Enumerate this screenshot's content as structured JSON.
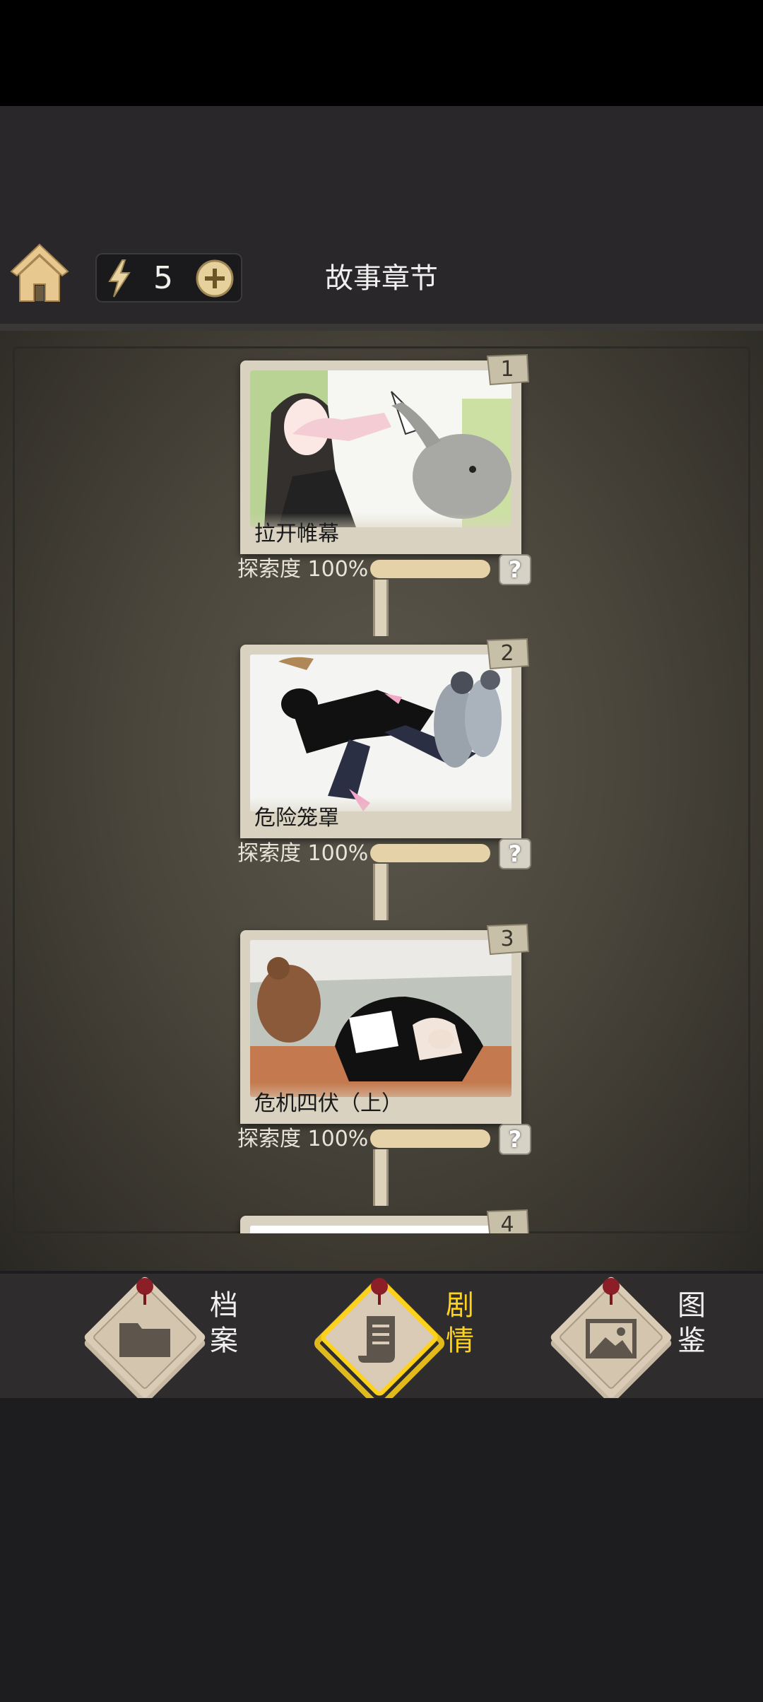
{
  "header": {
    "title": "故事章节",
    "energy": "5"
  },
  "chapters": [
    {
      "number": "1",
      "title": "拉开帷幕",
      "progress_label": "探索度 100%",
      "progress": 1.0,
      "help": "?"
    },
    {
      "number": "2",
      "title": "危险笼罩",
      "progress_label": "探索度 100%",
      "progress": 1.0,
      "help": "?"
    },
    {
      "number": "3",
      "title": "危机四伏（上）",
      "progress_label": "探索度 100%",
      "progress": 1.0,
      "help": "?"
    },
    {
      "number": "4"
    }
  ],
  "nav": {
    "archive": [
      "档",
      "案"
    ],
    "story": [
      "剧",
      "情"
    ],
    "gallery": [
      "图",
      "鉴"
    ],
    "active": "story"
  },
  "colors": {
    "accent": "#ffd21a",
    "progress_fill": "#e6d2a8",
    "card": "#d9d2c0"
  }
}
